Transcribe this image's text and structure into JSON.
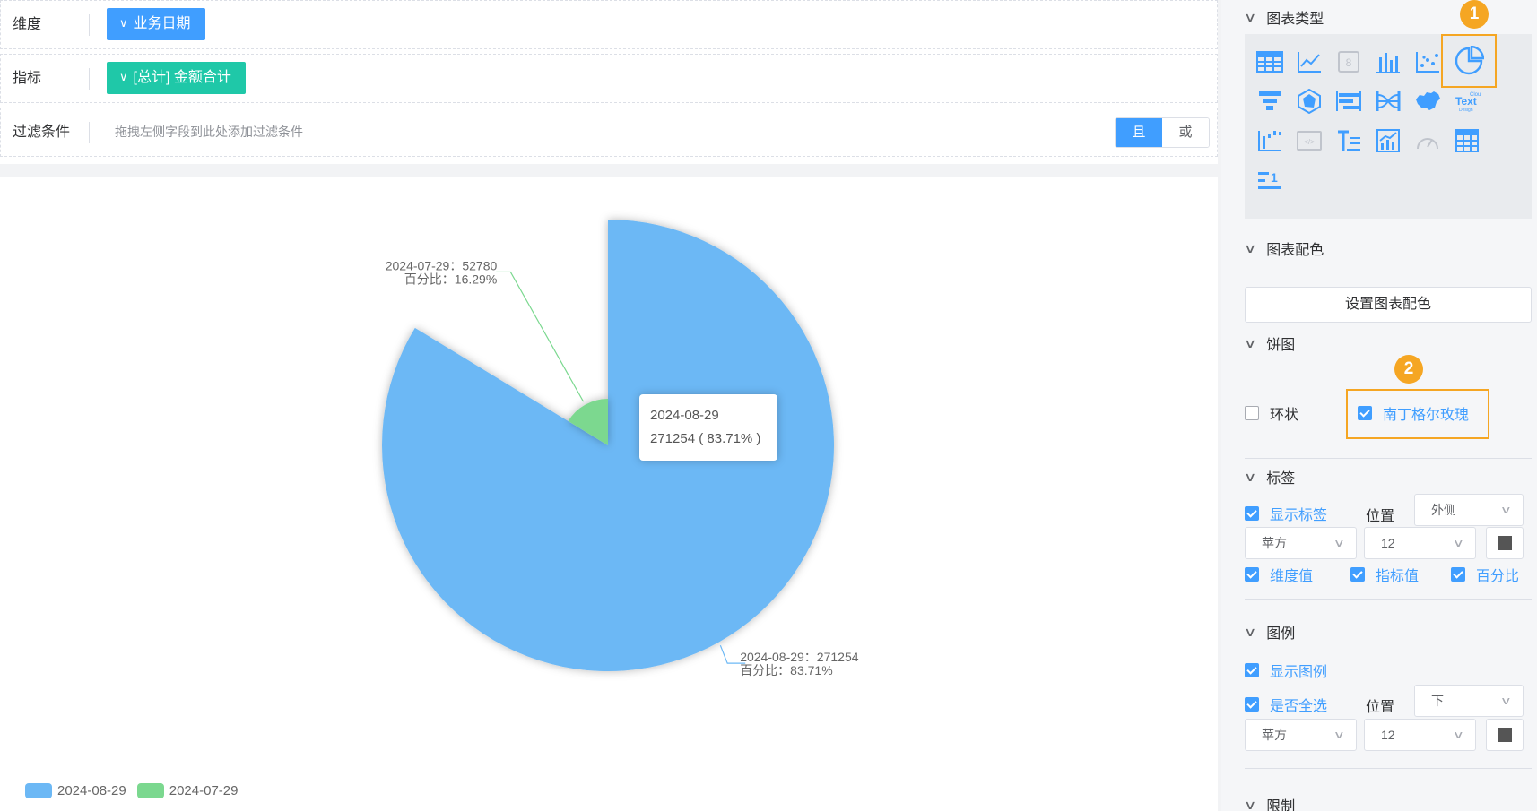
{
  "filters": {
    "dimension": {
      "label": "维度",
      "pill": "业务日期",
      "pill_color": "#409eff"
    },
    "metric": {
      "label": "指标",
      "pill": "[总计] 金额合计",
      "pill_color": "#1fc8a8"
    },
    "filter": {
      "label": "过滤条件",
      "placeholder": "拖拽左侧字段到此处添加过滤条件",
      "and_label": "且",
      "or_label": "或"
    }
  },
  "chart_data": {
    "type": "pie",
    "rose_type": "nightingale",
    "categories": [
      "2024-08-29",
      "2024-07-29"
    ],
    "values": [
      271254,
      52780
    ],
    "percents": [
      83.71,
      16.29
    ],
    "colors": [
      "#6cb8f5",
      "#7bd88f"
    ],
    "labels": [
      {
        "line1": "2024-08-29：271254",
        "line2": "百分比：83.71%"
      },
      {
        "line1": "2024-07-29：52780",
        "line2": "百分比：16.29%"
      }
    ],
    "legend_placement": "bottom-left"
  },
  "tooltip": {
    "title": "2024-08-29",
    "value": "271254 ( 83.71% )"
  },
  "legend": [
    {
      "label": "2024-08-29",
      "color": "#6cb8f5"
    },
    {
      "label": "2024-07-29",
      "color": "#7bd88f"
    }
  ],
  "panel": {
    "chart_type": {
      "title": "图表类型",
      "badge": "1",
      "icons": [
        "table-icon",
        "line-chart-icon",
        "kpi-icon",
        "bar-chart-icon",
        "scatter-icon",
        "pie-chart-icon",
        "funnel-icon",
        "radar-icon",
        "gantt-icon",
        "sankey-icon",
        "map-icon",
        "word-cloud-icon",
        "waterfall-icon",
        "html-icon",
        "text-icon",
        "area-icon",
        "gauge-icon",
        "pivot-table-icon",
        "ranking-icon"
      ],
      "selected": "pie-chart-icon"
    },
    "color": {
      "title": "图表配色",
      "button": "设置图表配色"
    },
    "pie": {
      "title": "饼图",
      "badge": "2",
      "ring_label": "环状",
      "ring_checked": false,
      "rose_label": "南丁格尔玫瑰",
      "rose_checked": true
    },
    "label": {
      "title": "标签",
      "show_label": "显示标签",
      "position_label": "位置",
      "position_value": "外侧",
      "font": "苹方",
      "size": "12",
      "dim_value": "维度值",
      "metric_value": "指标值",
      "percent": "百分比"
    },
    "legend": {
      "title": "图例",
      "show_legend": "显示图例",
      "select_all": "是否全选",
      "position_label": "位置",
      "position_value": "下",
      "font": "苹方",
      "size": "12"
    },
    "limit": {
      "title": "限制"
    }
  }
}
